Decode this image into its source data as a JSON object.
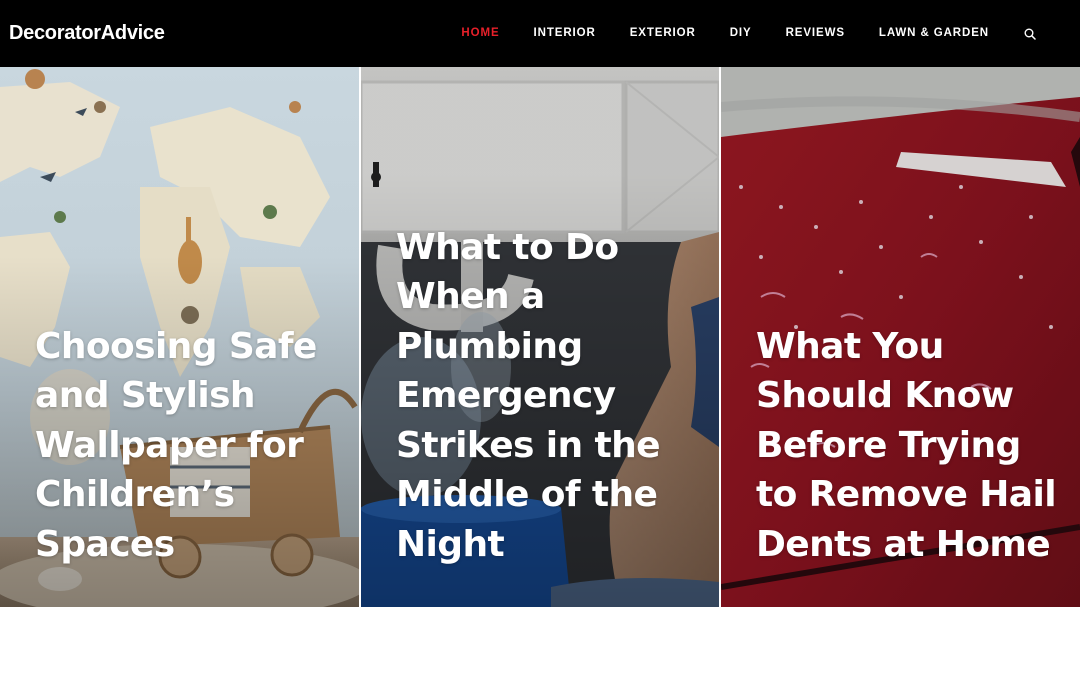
{
  "site": {
    "logo": "DecoratorAdvice"
  },
  "nav": {
    "items": [
      {
        "label": "HOME",
        "active": true
      },
      {
        "label": "INTERIOR"
      },
      {
        "label": "EXTERIOR"
      },
      {
        "label": "DIY"
      },
      {
        "label": "REVIEWS"
      },
      {
        "label": "LAWN & GARDEN"
      }
    ],
    "search_icon": "search-icon",
    "active_color": "#e8202a"
  },
  "cards": [
    {
      "title": "Choosing Safe and Stylish Wallpaper for Children’s Spaces"
    },
    {
      "title": "What to Do When a Plumbing Emergency Strikes in the Middle of the Night"
    },
    {
      "title": "What You Should Know Before Trying to Remove Hail Dents at Home"
    }
  ]
}
